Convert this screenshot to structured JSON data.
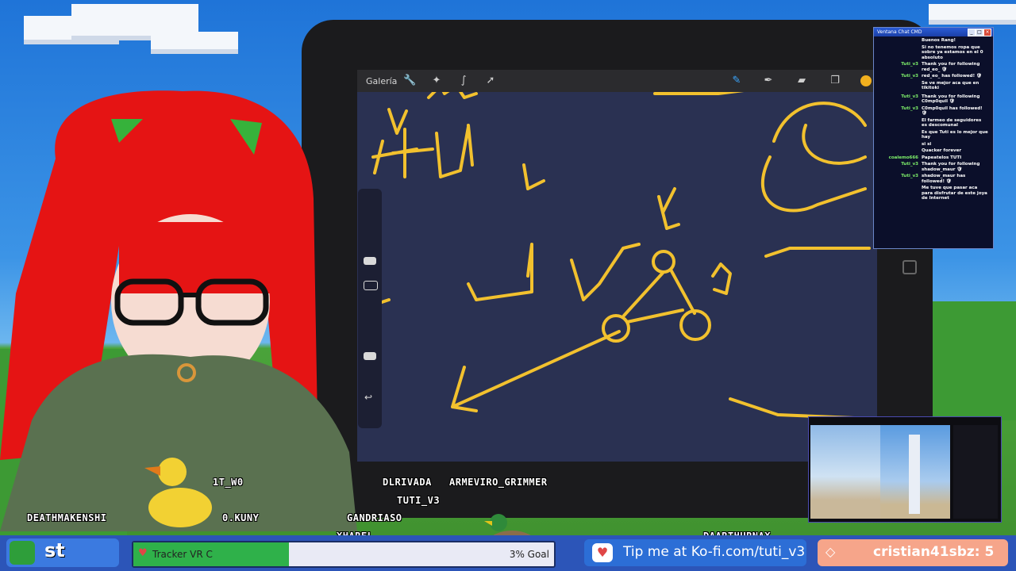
{
  "app": {
    "gallery_label": "Galería"
  },
  "chat": {
    "title": "Ventana Chat CMD",
    "buttons": [
      "_",
      "□",
      "×"
    ],
    "lines": [
      {
        "user": "",
        "msg": "Buenos Rang!"
      },
      {
        "user": "",
        "msg": "Si no tenemos ropa que sobre ya estamos en el 0 absoluto"
      },
      {
        "user": "Tuti_v3",
        "msg": "Thank you for following red_eo_ 🛡"
      },
      {
        "user": "Tuti_v3",
        "msg": "red_eo_ has followed! 🛡"
      },
      {
        "user": "",
        "msg": "Se ve mejor aca que en tikitoki"
      },
      {
        "user": "",
        "msg": ""
      },
      {
        "user": "Tuti_v3",
        "msg": "Thank you for following C0mp0quil 🛡"
      },
      {
        "user": "Tuti_v3",
        "msg": "C0mp0quil has followed! 🛡"
      },
      {
        "user": "",
        "msg": "El farmeo de seguidores es descomunal"
      },
      {
        "user": "",
        "msg": "Es que Tuti es lo mejor que hay"
      },
      {
        "user": "",
        "msg": "si si"
      },
      {
        "user": "",
        "msg": "Quacker forever"
      },
      {
        "user": "coalemo666",
        "msg": "Papeatelos TUTI"
      },
      {
        "user": "Tuti_v3",
        "msg": "Thank you for following shadow_maur 🛡"
      },
      {
        "user": "Tuti_v3",
        "msg": "shadow_maur has followed! 🛡"
      },
      {
        "user": "",
        "msg": "Me tuve que pasar aca para disfrutar de este joya de Internet"
      }
    ]
  },
  "usernames": {
    "u1": "1T_W0",
    "u2": "DEATHMAKENSHI",
    "u3": "0.KUNY",
    "u4": "DLRIVADA",
    "u5": "ARMEVIRO_GRIMMER",
    "u6": "TUTI_V3",
    "u7": "GANDRIASO",
    "u8": "XHAREL",
    "u9": "DAARTHURNAX"
  },
  "bottom": {
    "start_label": "st",
    "tracker_label": "Tracker VR C",
    "tracker_goal": "3% Goal",
    "tracker_progress": 0.37,
    "kofi_label": "Tip me at Ko-fi.com/tuti_v3",
    "donor_label": "cristian41sbz: 5"
  },
  "colors": {
    "drawing_stroke": "#f2c12e",
    "canvas_bg": "#2a3152",
    "bar_bg": "#2c55b8"
  }
}
